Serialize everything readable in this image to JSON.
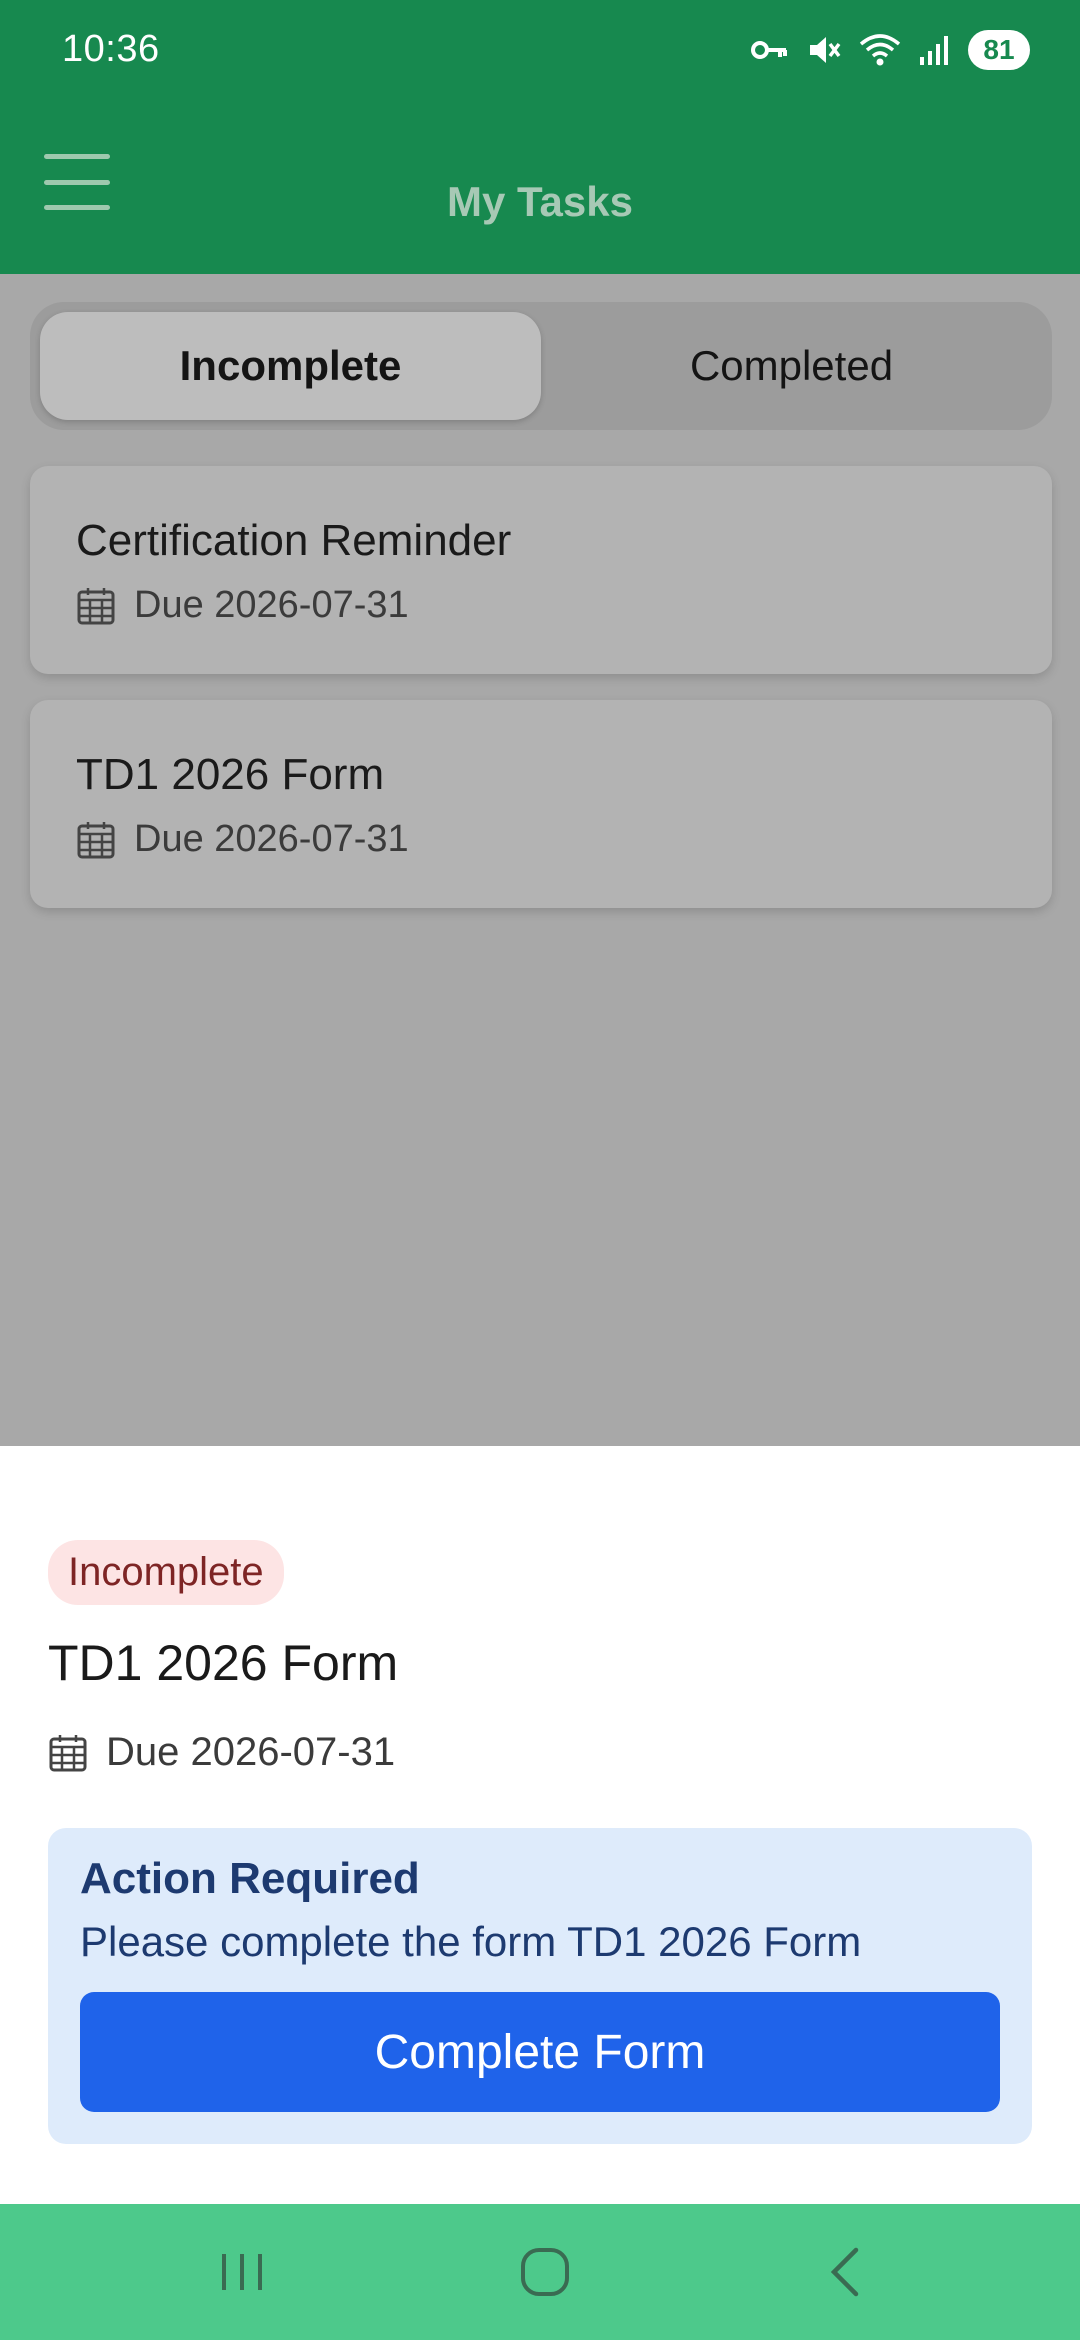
{
  "status_bar": {
    "time": "10:36",
    "battery": "81",
    "icons": [
      "vpn-key-icon",
      "mute-icon",
      "wifi-icon",
      "signal-icon",
      "battery-icon"
    ]
  },
  "app_bar": {
    "title": "My Tasks",
    "menu_icon": "hamburger-menu-icon"
  },
  "tabs": [
    {
      "label": "Incomplete",
      "active": true
    },
    {
      "label": "Completed",
      "active": false
    }
  ],
  "tasks": [
    {
      "title": "Certification Reminder",
      "due": "Due 2026-07-31"
    },
    {
      "title": "TD1 2026 Form",
      "due": "Due 2026-07-31"
    }
  ],
  "sheet": {
    "status_badge": "Incomplete",
    "title": "TD1 2026 Form",
    "due": "Due 2026-07-31",
    "action_title": "Action Required",
    "action_text": "Please complete the form TD1 2026 Form",
    "button_label": "Complete Form"
  },
  "colors": {
    "primary_green": "#17894f",
    "nav_green": "#4dc98b",
    "button_blue": "#1f63ea",
    "badge_bg": "#fde4e4",
    "badge_text": "#7e2525",
    "action_bg": "#deebfb"
  },
  "nav_bar": {
    "icons": [
      "recent-apps-icon",
      "home-icon",
      "back-icon"
    ]
  }
}
